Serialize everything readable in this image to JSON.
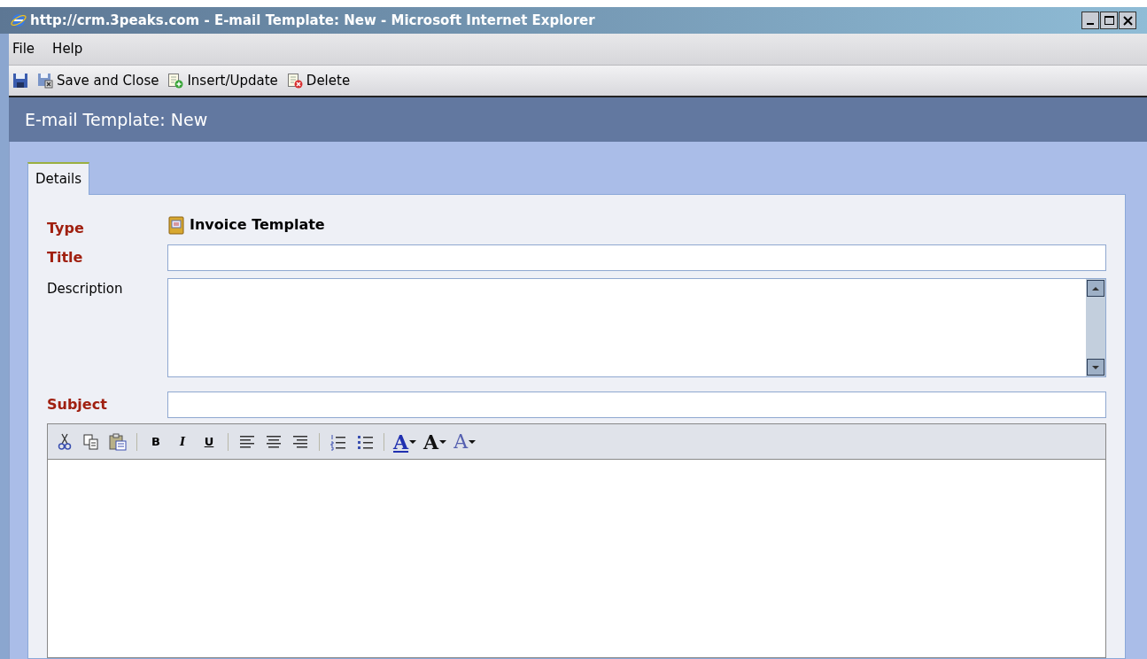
{
  "window": {
    "title": "http://crm.3peaks.com - E-mail Template: New - Microsoft Internet Explorer"
  },
  "menu": [
    {
      "label": "File"
    },
    {
      "label": "Help"
    }
  ],
  "toolbar": [
    {
      "kind": "save"
    },
    {
      "kind": "save-close",
      "label": "Save and Close"
    },
    {
      "kind": "insert",
      "label": "Insert/Update"
    },
    {
      "kind": "delete",
      "label": "Delete"
    }
  ],
  "header": "E-mail Template: New",
  "tabs": [
    {
      "label": "Details",
      "selected": true
    }
  ],
  "form": {
    "type_label": "Type",
    "type_value": "Invoice Template",
    "title_label": "Title",
    "description_label": "Description",
    "subject_label": "Subject"
  },
  "editor_tools": [
    {
      "kind": "cut"
    },
    {
      "kind": "copy"
    },
    {
      "kind": "paste"
    },
    {
      "kind": "sep"
    },
    {
      "kind": "bold",
      "label": "B"
    },
    {
      "kind": "italic",
      "label": "I"
    },
    {
      "kind": "underline",
      "label": "U"
    },
    {
      "kind": "sep"
    },
    {
      "kind": "align-left"
    },
    {
      "kind": "align-center"
    },
    {
      "kind": "align-right"
    },
    {
      "kind": "sep"
    },
    {
      "kind": "ordered-list"
    },
    {
      "kind": "bullet-list"
    },
    {
      "kind": "sep"
    },
    {
      "kind": "highlight",
      "label": "A"
    },
    {
      "kind": "size",
      "label": "A"
    },
    {
      "kind": "color",
      "label": "A"
    }
  ]
}
